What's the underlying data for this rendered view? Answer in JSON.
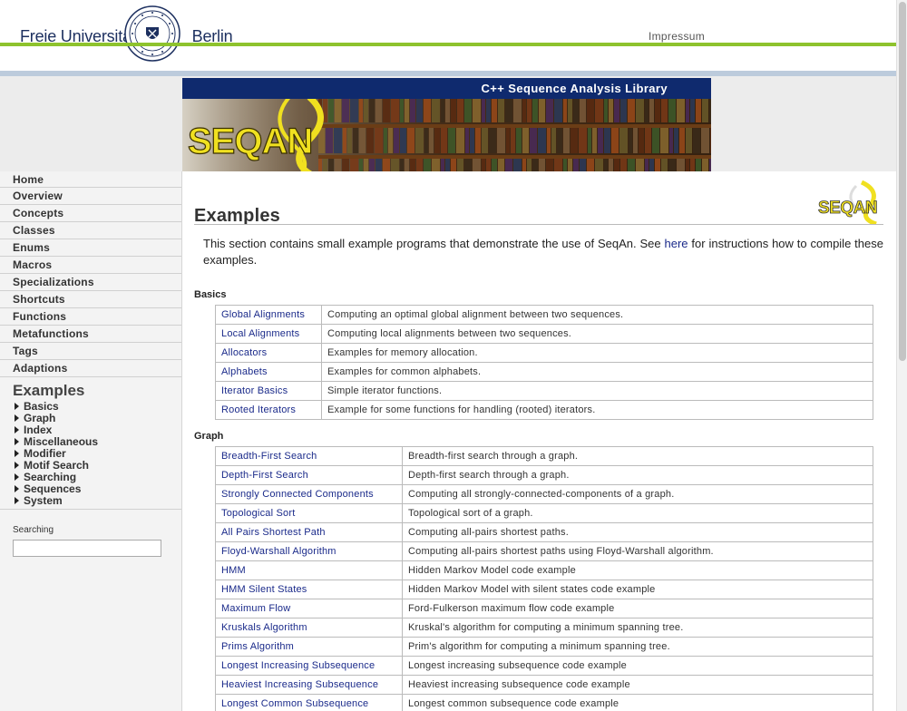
{
  "header": {
    "brand_left": "Freie Universität",
    "brand_right": "Berlin",
    "impressum": "Impressum"
  },
  "banner": {
    "title": "C++ Sequence Analysis Library",
    "logo_text": "SEQAN"
  },
  "colors": {
    "fu_green": "#8ec32d",
    "fu_blue_line": "#bccbdc",
    "banner_navy": "#0f2a6e",
    "seqan_yellow": "#f0e020",
    "link": "#1a2a8a"
  },
  "sidebar": {
    "nav": [
      {
        "label": "Home"
      },
      {
        "label": "Overview"
      },
      {
        "label": "Concepts"
      },
      {
        "label": "Classes"
      },
      {
        "label": "Enums"
      },
      {
        "label": "Macros"
      },
      {
        "label": "Specializations"
      },
      {
        "label": "Shortcuts"
      },
      {
        "label": "Functions"
      },
      {
        "label": "Metafunctions"
      },
      {
        "label": "Tags"
      },
      {
        "label": "Adaptions"
      }
    ],
    "current": "Examples",
    "sub": [
      {
        "label": "Basics"
      },
      {
        "label": "Graph"
      },
      {
        "label": "Index"
      },
      {
        "label": "Miscellaneous"
      },
      {
        "label": "Modifier"
      },
      {
        "label": "Motif Search"
      },
      {
        "label": "Searching"
      },
      {
        "label": "Sequences"
      },
      {
        "label": "System"
      }
    ],
    "search_label": "Searching",
    "search_value": ""
  },
  "main": {
    "title": "Examples",
    "intro_before": "This section contains small example programs that demonstrate the use of SeqAn. See ",
    "intro_link": "here",
    "intro_after": " for instructions how to compile these examples.",
    "sections": [
      {
        "heading": "Basics",
        "rows": [
          {
            "name": "Global Alignments",
            "desc": "Computing an optimal global alignment between two sequences."
          },
          {
            "name": "Local Alignments",
            "desc": "Computing local alignments between two sequences."
          },
          {
            "name": "Allocators",
            "desc": "Examples for memory allocation."
          },
          {
            "name": "Alphabets",
            "desc": "Examples for common alphabets."
          },
          {
            "name": "Iterator Basics",
            "desc": "Simple iterator functions."
          },
          {
            "name": "Rooted Iterators",
            "desc": "Example for some functions for handling (rooted) iterators."
          }
        ]
      },
      {
        "heading": "Graph",
        "rows": [
          {
            "name": "Breadth-First Search",
            "desc": "Breadth-first search through a graph."
          },
          {
            "name": "Depth-First Search",
            "desc": "Depth-first search through a graph."
          },
          {
            "name": "Strongly Connected Components",
            "desc": "Computing all strongly-connected-components of a graph."
          },
          {
            "name": "Topological Sort",
            "desc": "Topological sort of a graph."
          },
          {
            "name": "All Pairs Shortest Path",
            "desc": "Computing all-pairs shortest paths."
          },
          {
            "name": "Floyd-Warshall Algorithm",
            "desc": "Computing all-pairs shortest paths using Floyd-Warshall algorithm."
          },
          {
            "name": "HMM",
            "desc": "Hidden Markov Model code example"
          },
          {
            "name": "HMM Silent States",
            "desc": "Hidden Markov Model with silent states code example"
          },
          {
            "name": "Maximum Flow",
            "desc": "Ford-Fulkerson maximum flow code example"
          },
          {
            "name": "Kruskals Algorithm",
            "desc": "Kruskal's algorithm for computing a minimum spanning tree."
          },
          {
            "name": "Prims Algorithm",
            "desc": "Prim's algorithm for computing a minimum spanning tree."
          },
          {
            "name": "Longest Increasing Subsequence",
            "desc": "Longest increasing subsequence code example"
          },
          {
            "name": "Heaviest Increasing Subsequence",
            "desc": "Heaviest increasing subsequence code example"
          },
          {
            "name": "Longest Common Subsequence",
            "desc": "Longest common subsequence code example"
          }
        ]
      }
    ]
  }
}
